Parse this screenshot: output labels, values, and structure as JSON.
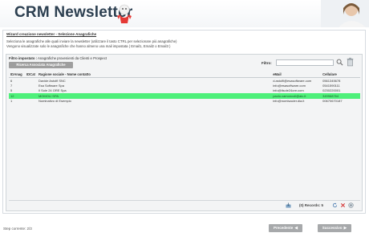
{
  "header": {
    "title": "CRM Newsletter"
  },
  "wizard": {
    "title": "Wizard creazione newsletter - Selezione Anagrafiche",
    "desc_line1": "Seleziona le anagrafiche alle quali inviare la newsletter (utilizzare il tasto CTRL per selezionare più anagrafiche)",
    "desc_line2": "Vengono visualizzate solo le anagrafiche che hanno almeno una mail impostata ( Email1, Email2 o Email3 )"
  },
  "filter": {
    "label_bold": "Filtro impostato :",
    "label_text": " Anagrafiche provenienti da Clienti e Prospect",
    "assoc_button": "Ricerca Associata Anagrafiche",
    "search_label": "Filtro:",
    "search_value": ""
  },
  "table": {
    "columns": [
      "IDAnag",
      "IDCat",
      "Ragione sociale - Nome contatto",
      "eMail",
      "Cellulare"
    ],
    "rows": [
      {
        "id": "6",
        "cat": "",
        "name": "Davide Astolfi SNC",
        "email": "d.astolfi@esasoftware.com",
        "cell": "0561345678"
      },
      {
        "id": "7",
        "cat": "",
        "name": "Esa Software Spa",
        "email": "info@esasoftware.com",
        "cell": "0541590111"
      },
      {
        "id": "5",
        "cat": "",
        "name": "Il Sole 24 ORE Spa",
        "email": "info@ilsole24ore.com",
        "cell": "0230220001"
      },
      {
        "id": "12",
        "cat": "",
        "name": "MOMOLI SPA",
        "email": "paolo.camoncoli@aic.it",
        "cell": "349968764",
        "selected": true
      },
      {
        "id": "1",
        "cat": "",
        "name": "Nominativo di Esempio",
        "email": "info@nomisacier.dia.it",
        "cell": "00670670187"
      }
    ]
  },
  "status": {
    "records_label": "(0) Records: 5"
  },
  "footer": {
    "step": "Step corrente: 2/3",
    "prev_button": "Precedente",
    "next_button": "Successivo"
  }
}
